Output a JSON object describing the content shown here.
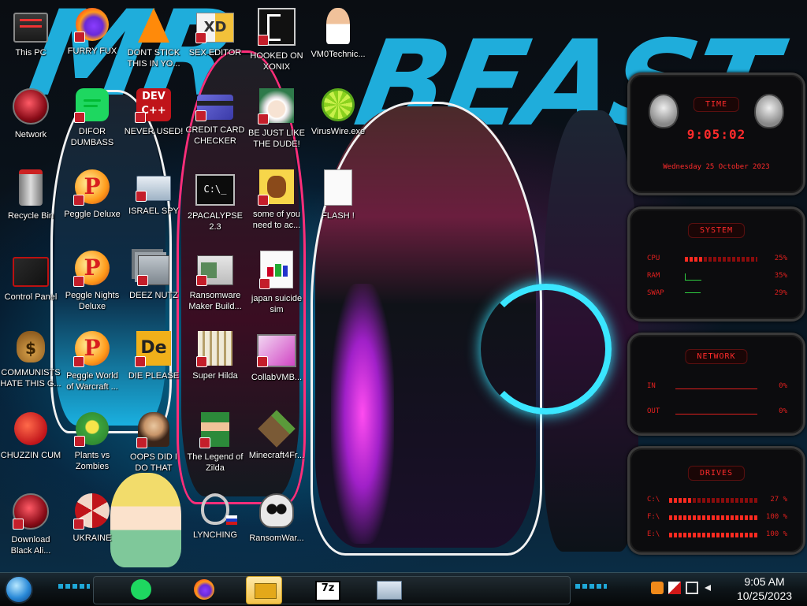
{
  "desktop": {
    "icons": [
      {
        "label": "This PC",
        "icon": "computer-icon"
      },
      {
        "label": "FURRY FUX",
        "icon": "firefox-icon"
      },
      {
        "label": "DONT STICK THIS IN YO...",
        "icon": "vlc-cone-icon"
      },
      {
        "label": "SEX EDITOR",
        "icon": "editor-icon"
      },
      {
        "label": "HOOKED ON XONIX",
        "icon": "xonix-game-icon"
      },
      {
        "label": "VM0Technic...",
        "icon": "technician-icon"
      },
      {
        "label": "Network",
        "icon": "network-icon"
      },
      {
        "label": "DIFOR DUMBASS",
        "icon": "chat-app-icon"
      },
      {
        "label": "NEVER USED!",
        "icon": "dev-cpp-icon"
      },
      {
        "label": "CREDIT CARD CHECKER",
        "icon": "credit-card-icon"
      },
      {
        "label": "BE JUST LIKE THE DUDE!",
        "icon": "santa-icon"
      },
      {
        "label": "VirusWire.exe",
        "icon": "lime-icon"
      },
      {
        "label": "Recycle Bin",
        "icon": "recycle-bin-icon"
      },
      {
        "label": "Peggle Deluxe",
        "icon": "peggle-icon"
      },
      {
        "label": "ISRAEL SPY",
        "icon": "remote-desktop-icon"
      },
      {
        "label": "2PACALYPSE 2.3",
        "icon": "terminal-icon"
      },
      {
        "label": "some of you need to ac...",
        "icon": "beaver-icon"
      },
      {
        "label": "FLASH !",
        "icon": "document-icon"
      },
      {
        "label": "Control Panel",
        "icon": "control-panel-icon"
      },
      {
        "label": "Peggle Nights Deluxe",
        "icon": "peggle-icon"
      },
      {
        "label": "DEEZ NUTZ",
        "icon": "windows-stack-icon"
      },
      {
        "label": "Ransomware Maker Build...",
        "icon": "program-window-icon"
      },
      {
        "label": "japan suicide sim",
        "icon": "installer-icon"
      },
      {
        "label": "COMMUNISTS HATE THIS G...",
        "icon": "money-bag-icon"
      },
      {
        "label": "Peggle World of Warcraft ...",
        "icon": "peggle-icon"
      },
      {
        "label": "DIE PLEASE",
        "icon": "de-logo-icon"
      },
      {
        "label": "Super Hilda",
        "icon": "pixel-cat-icon"
      },
      {
        "label": "CollabVMB...",
        "icon": "collabvm-icon"
      },
      {
        "label": "CHUZZIN CUM",
        "icon": "chuzzle-icon"
      },
      {
        "label": "Plants vs Zombies",
        "icon": "plants-icon"
      },
      {
        "label": "OOPS DID I DO THAT",
        "icon": "portrait-icon"
      },
      {
        "label": "The Legend of Zilda",
        "icon": "zelda-sprite-icon"
      },
      {
        "label": "Minecraft4Fr...",
        "icon": "minecraft-block-icon"
      },
      {
        "label": "Download Black Ali...",
        "icon": "alienware-icon"
      },
      {
        "label": "UKRAINE",
        "icon": "radiation-icon"
      },
      {
        "label": "LYNCHING",
        "icon": "noose-icon"
      },
      {
        "label": "RansomWar...",
        "icon": "skull-icon"
      }
    ]
  },
  "widget": {
    "time_title": "TIME",
    "time": "9:05:02",
    "date": "Wednesday 25 October 2023",
    "system_title": "SYSTEM",
    "system": [
      {
        "label": "CPU",
        "value": "25%",
        "pct": 25
      },
      {
        "label": "RAM",
        "value": "35%",
        "pct": 35
      },
      {
        "label": "SWAP",
        "value": "29%",
        "pct": 29
      }
    ],
    "network_title": "NETWORK",
    "network": [
      {
        "label": "IN",
        "value": "0%"
      },
      {
        "label": "OUT",
        "value": "0%"
      }
    ],
    "drives_title": "DRIVES",
    "drives": [
      {
        "label": "C:\\",
        "value": "27 %",
        "pct": 27
      },
      {
        "label": "F:\\",
        "value": "100 %",
        "pct": 100
      },
      {
        "label": "E:\\",
        "value": "100 %",
        "pct": 100
      }
    ]
  },
  "taskbar": {
    "pinned": [
      "chat-app-icon",
      "firefox-icon",
      "file-explorer-icon",
      "7zip-icon",
      "system-monitor-icon"
    ],
    "seven_zip_label": "7z",
    "clock_time": "9:05 AM",
    "clock_date": "10/25/2023"
  },
  "colors": {
    "accent": "#21b6e6",
    "widget_red": "#ff2b2b",
    "badge_red": "#c41e2a"
  }
}
